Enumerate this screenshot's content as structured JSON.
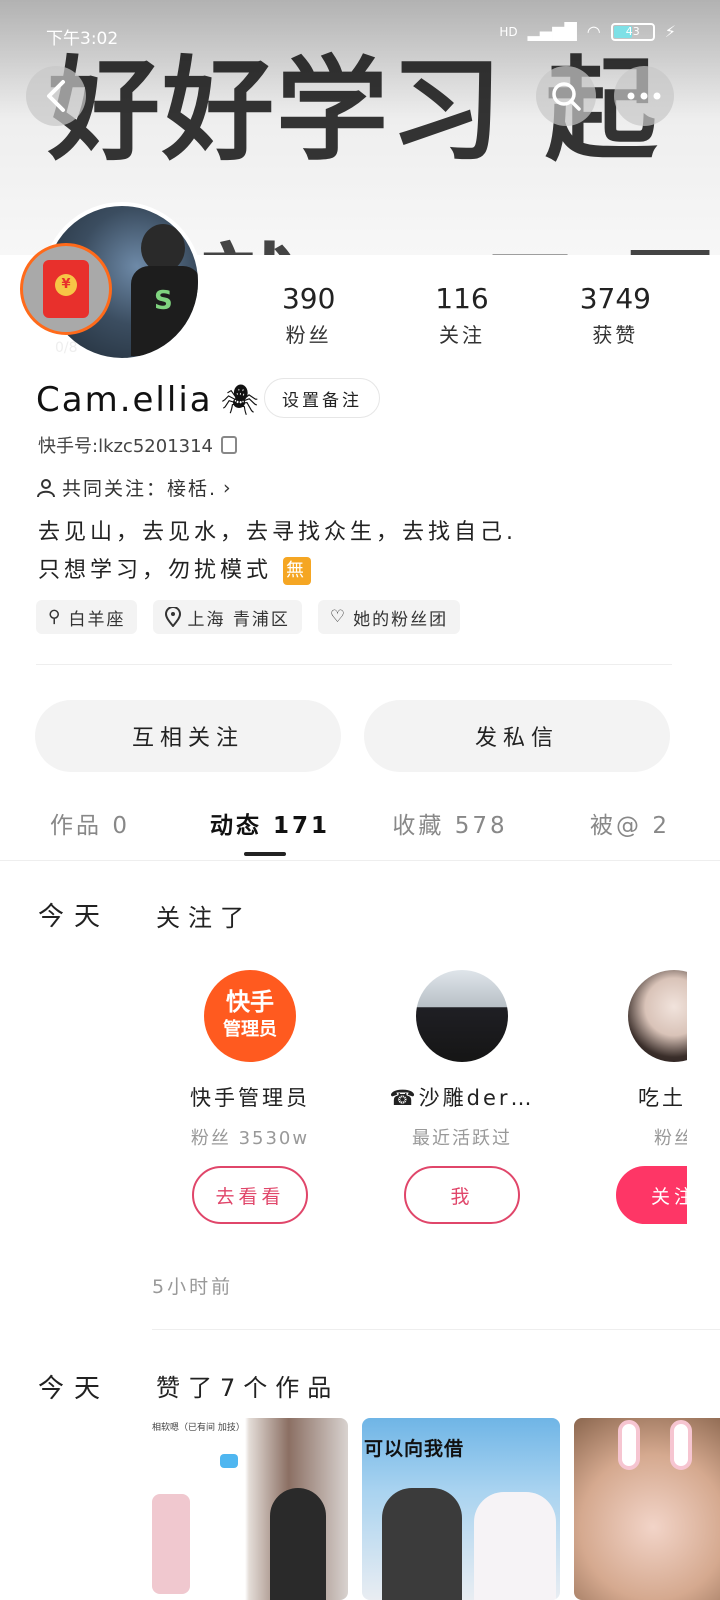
{
  "status_bar": {
    "time": "下午3:02",
    "network": "HD",
    "battery": "43"
  },
  "banner": {
    "text": "好好学习 起",
    "text2": "就一二三"
  },
  "profile": {
    "nickname": "Cam.ellia",
    "remark_button": "设置备注",
    "kwai_id": "快手号:lkzc5201314",
    "common_follow": "共同关注：椄栝.",
    "bio_line1": "去见山，去见水，去寻找众生，去找自己.",
    "bio_line2": "只想学习，勿扰模式",
    "bio_badge": "無",
    "redpack_count": "0/8"
  },
  "stats": [
    {
      "value": "390",
      "label": "粉丝"
    },
    {
      "value": "116",
      "label": "关注"
    },
    {
      "value": "3749",
      "label": "获赞"
    }
  ],
  "tags": [
    "白羊座",
    "上海 青浦区",
    "她的粉丝团"
  ],
  "actions": {
    "follow_each": "互相关注",
    "message": "发私信"
  },
  "tabs": [
    "作品 0",
    "动态 171",
    "收藏 578",
    "被@ 2"
  ],
  "feed": {
    "event1": {
      "day": "今天",
      "title": "关注了",
      "cards": [
        {
          "logo_line1": "快手",
          "logo_line2": "管理员",
          "name": "快手管理员",
          "sub": "粉丝 3530w",
          "button": "去看看"
        },
        {
          "name": "☎沙雕der…",
          "sub": "最近活跃过",
          "button": "我"
        },
        {
          "name": "吃土豆",
          "sub": "粉丝",
          "button": "关注"
        }
      ],
      "time_ago": "5小时前"
    },
    "event2": {
      "day": "今天",
      "title": "赞了7个作品",
      "thumb1_caption": "相软嗯（已有间 加技）",
      "thumb2_caption": "可以向我借"
    }
  },
  "colors": {
    "accent": "#fe3666",
    "kuaishou": "#ff5a1f"
  }
}
